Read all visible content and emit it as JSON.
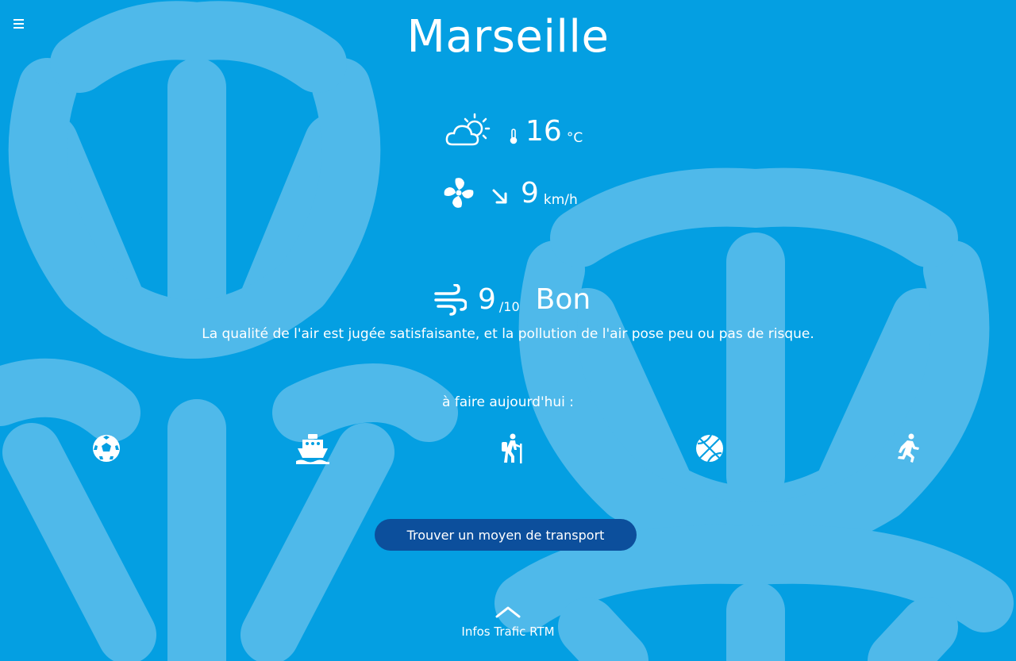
{
  "page": {
    "city": "Marseille"
  },
  "weather": {
    "icon": "partly-cloudy-icon",
    "temperature": "16",
    "temperature_unit": "°C"
  },
  "wind": {
    "icon": "fan-icon",
    "direction_icon": "arrow-down-right-icon",
    "speed": "9",
    "speed_unit": "km/h"
  },
  "air_quality": {
    "icon": "wind-icon",
    "score": "9",
    "scale": "/10",
    "label": "Bon",
    "description": "La qualité de l'air est jugée satisfaisante, et la pollution de l'air pose peu ou pas de risque."
  },
  "activities": {
    "title": "à faire aujourd'hui :",
    "items": [
      {
        "icon": "soccer-ball-icon"
      },
      {
        "icon": "boat-icon"
      },
      {
        "icon": "hiking-icon"
      },
      {
        "icon": "basketball-icon"
      },
      {
        "icon": "running-icon"
      }
    ]
  },
  "cta": {
    "label": "Trouver un moyen de transport"
  },
  "traffic": {
    "label": "Infos Trafic RTM",
    "icon": "chevron-up-icon"
  },
  "colors": {
    "background": "#049fe2",
    "pattern": "#4fb9ea",
    "button": "#0c4f9c",
    "text": "#ffffff"
  }
}
